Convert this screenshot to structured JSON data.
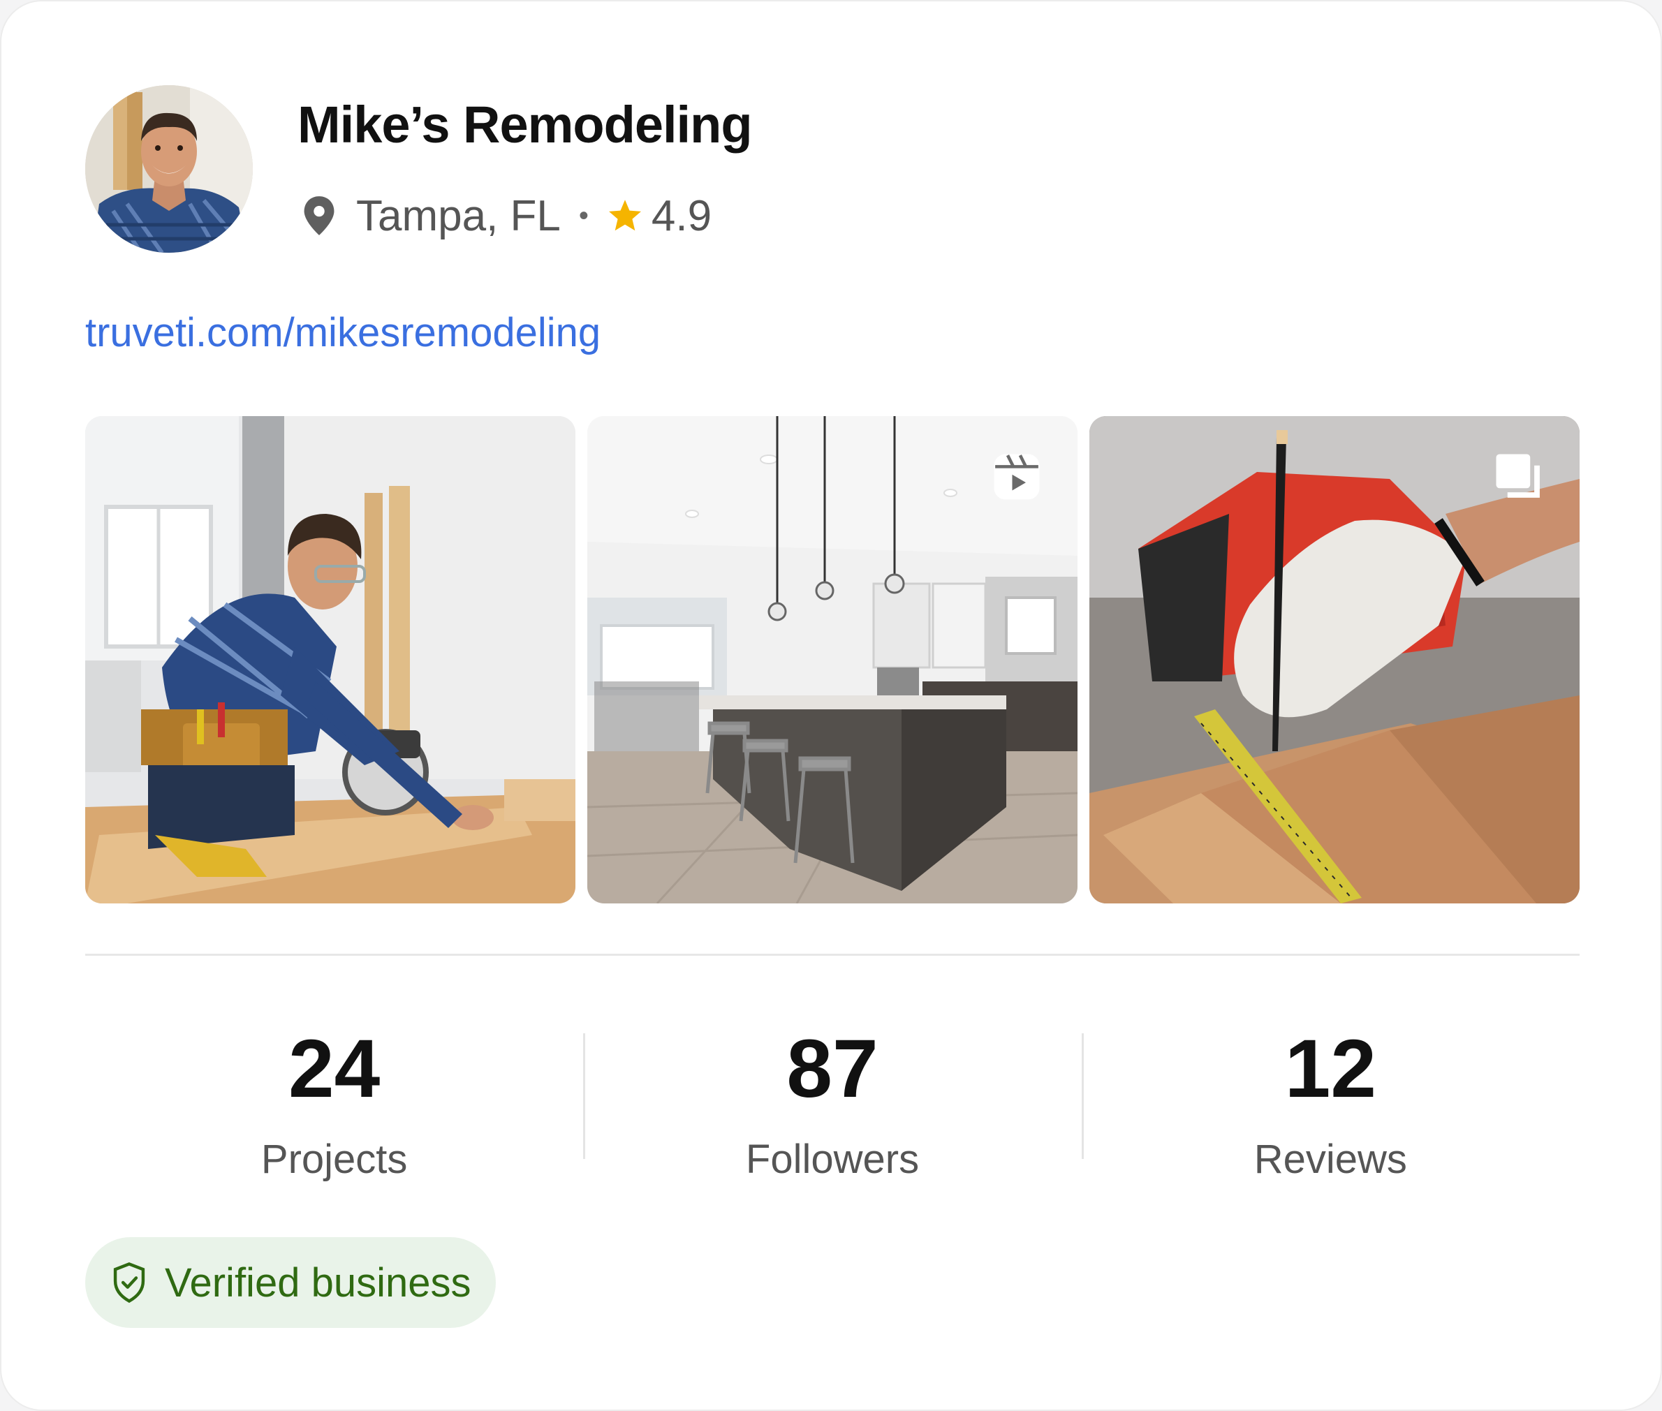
{
  "profile": {
    "name": "Mike’s Remodeling",
    "location": "Tampa, FL",
    "separator": "•",
    "rating": "4.9",
    "link": "truveti.com/mikesremodeling",
    "avatar_icon": "person-photo"
  },
  "gallery": {
    "items": [
      {
        "kind": "photo",
        "subject": "carpenter cutting wood with circular saw"
      },
      {
        "kind": "reel",
        "subject": "modern kitchen with island and bar stools",
        "badge_icon": "reel-icon"
      },
      {
        "kind": "carousel",
        "subject": "gloved hand marking wood with pencil and tape measure",
        "badge_icon": "multiple-photos-icon"
      }
    ]
  },
  "stats": [
    {
      "value": "24",
      "label": "Projects"
    },
    {
      "value": "87",
      "label": "Followers"
    },
    {
      "value": "12",
      "label": "Reviews"
    }
  ],
  "badge": {
    "label": "Verified business",
    "icon": "shield-check-icon"
  },
  "colors": {
    "link": "#3a6fe0",
    "star": "#f5b400",
    "verified_bg": "#e9f3e9",
    "verified_text": "#2f6a12"
  }
}
